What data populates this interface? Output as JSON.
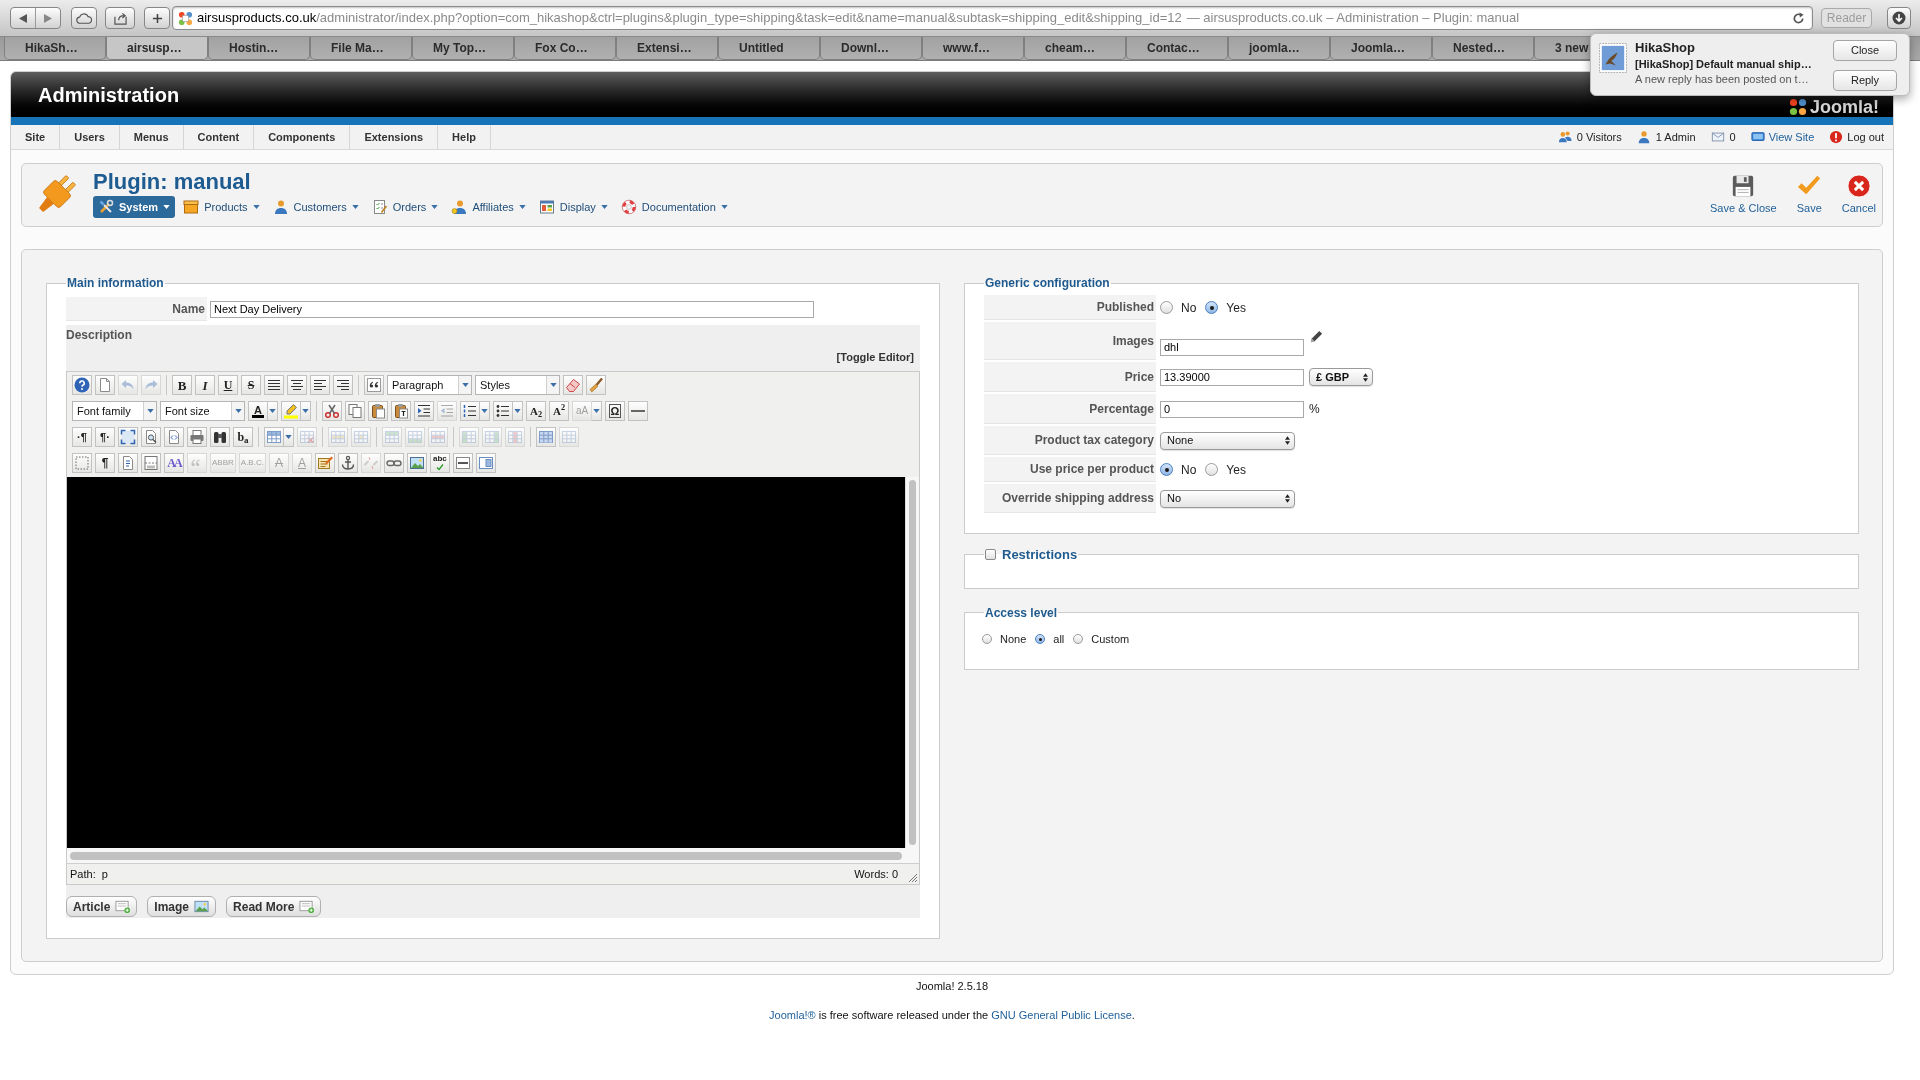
{
  "browser": {
    "url_domain": "airsusproducts.co.uk",
    "url_path": "/administrator/index.php?option=com_hikashop&ctrl=plugins&plugin_type=shipping&task=edit&name=manual&subtask=shipping_edit&shipping_id=12",
    "page_title": "— airsusproducts.co.uk – Administration – Plugin: manual",
    "reader": "Reader",
    "tabs": [
      {
        "label": "HikaSh…",
        "selected": false
      },
      {
        "label": "airsusp…",
        "selected": true
      },
      {
        "label": "Hostin…",
        "selected": false
      },
      {
        "label": "File Ma…",
        "selected": false
      },
      {
        "label": "My Top…",
        "selected": false
      },
      {
        "label": "Fox Co…",
        "selected": false
      },
      {
        "label": "Extensi…",
        "selected": false
      },
      {
        "label": "Untitled",
        "selected": false
      },
      {
        "label": "Downl…",
        "selected": false
      },
      {
        "label": "www.f…",
        "selected": false
      },
      {
        "label": "cheam…",
        "selected": false
      },
      {
        "label": "Contac…",
        "selected": false
      },
      {
        "label": "joomla…",
        "selected": false
      },
      {
        "label": "Joomla…",
        "selected": false
      },
      {
        "label": "Nested…",
        "selected": false
      },
      {
        "label": "3 new",
        "selected": false
      }
    ]
  },
  "notification": {
    "app": "HikaShop",
    "subject": "[HikaShop] Default manual ship…",
    "body": "A new reply has been posted on t…",
    "buttons": [
      "Close",
      "Reply"
    ]
  },
  "header": {
    "title": "Administration",
    "logo": "Joomla!"
  },
  "menu": {
    "items": [
      "Site",
      "Users",
      "Menus",
      "Content",
      "Components",
      "Extensions",
      "Help"
    ],
    "status": [
      {
        "kind": "visitors",
        "label": "0 Visitors"
      },
      {
        "kind": "admins",
        "label": "1 Admin"
      },
      {
        "kind": "messages",
        "label": "0"
      },
      {
        "kind": "view_site",
        "label": "View Site"
      },
      {
        "kind": "logout",
        "label": "Log out"
      }
    ]
  },
  "toolbar": {
    "title": "Plugin: manual",
    "submenu": [
      {
        "kind": "system",
        "label": "System",
        "selected": true
      },
      {
        "kind": "products",
        "label": "Products",
        "selected": false
      },
      {
        "kind": "customers",
        "label": "Customers",
        "selected": false
      },
      {
        "kind": "orders",
        "label": "Orders",
        "selected": false
      },
      {
        "kind": "affiliates",
        "label": "Affiliates",
        "selected": false
      },
      {
        "kind": "display",
        "label": "Display",
        "selected": false
      },
      {
        "kind": "documentation",
        "label": "Documentation",
        "selected": false
      }
    ],
    "actions": [
      {
        "kind": "save_close",
        "label": "Save & Close"
      },
      {
        "kind": "save",
        "label": "Save"
      },
      {
        "kind": "cancel",
        "label": "Cancel"
      }
    ]
  },
  "main_information": {
    "legend": "Main information",
    "name": {
      "label": "Name",
      "value": "Next Day Delivery"
    },
    "description": {
      "label": "Description",
      "toggle": "[Toggle Editor]",
      "toolbar": [
        [
          [
            {
              "kind": "help",
              "disabled": false
            },
            {
              "kind": "newdocument",
              "disabled": false
            },
            {
              "kind": "undo",
              "disabled": true
            },
            {
              "kind": "redo",
              "disabled": true
            }
          ],
          [
            {
              "kind": "bold",
              "glyph": "B",
              "disabled": false
            },
            {
              "kind": "italic",
              "glyph": "I",
              "disabled": false
            },
            {
              "kind": "underline",
              "glyph": "U",
              "disabled": false
            },
            {
              "kind": "strike",
              "glyph": "S",
              "disabled": false
            },
            {
              "kind": "justifyfull",
              "disabled": false
            },
            {
              "kind": "justifycenter",
              "disabled": false
            },
            {
              "kind": "justifyleft",
              "disabled": false
            },
            {
              "kind": "justifyright",
              "disabled": false
            }
          ],
          [
            {
              "kind": "blockquote",
              "disabled": false
            },
            {
              "kind": "select",
              "label": "Paragraph",
              "disabled": false
            },
            {
              "kind": "select",
              "label": "Styles",
              "disabled": false
            },
            {
              "kind": "cleanup",
              "disabled": false
            },
            {
              "kind": "removeformat",
              "disabled": false
            }
          ]
        ],
        [
          [
            {
              "kind": "select",
              "label": "Font family",
              "disabled": false
            },
            {
              "kind": "select",
              "label": "Font size",
              "disabled": false
            },
            {
              "kind": "forecolor",
              "glyph": "A",
              "split": true,
              "disabled": false
            },
            {
              "kind": "hilitecolor",
              "split": true,
              "disabled": false
            }
          ],
          [
            {
              "kind": "cut",
              "disabled": false
            },
            {
              "kind": "copy",
              "disabled": false
            },
            {
              "kind": "paste",
              "disabled": false
            },
            {
              "kind": "pastetext",
              "disabled": false
            },
            {
              "kind": "indent",
              "disabled": false
            },
            {
              "kind": "outdent",
              "disabled": true
            },
            {
              "kind": "numlist",
              "split": true,
              "disabled": false
            },
            {
              "kind": "bullist",
              "split": true,
              "disabled": false
            },
            {
              "kind": "sub",
              "glyph": "A$_{2}$",
              "disabled": false
            },
            {
              "kind": "sup",
              "glyph": "A$^{2}$",
              "disabled": false
            },
            {
              "kind": "fontstyle",
              "glyph": "aA",
              "split": true,
              "disabled": true
            },
            {
              "kind": "charmap",
              "glyph": "Ω",
              "disabled": false
            },
            {
              "kind": "hr",
              "disabled": false
            }
          ]
        ],
        [
          [
            {
              "kind": "ltr",
              "glyph": "·¶",
              "disabled": false
            },
            {
              "kind": "rtl",
              "glyph": "¶·",
              "disabled": false
            },
            {
              "kind": "fullscreen",
              "disabled": false
            },
            {
              "kind": "preview",
              "disabled": false
            },
            {
              "kind": "code",
              "disabled": false
            },
            {
              "kind": "print",
              "disabled": false
            },
            {
              "kind": "find",
              "disabled": false
            },
            {
              "kind": "replace",
              "glyph": "b$_{a}$",
              "disabled": false
            }
          ],
          [
            {
              "kind": "table",
              "split": true,
              "disabled": false
            },
            {
              "kind": "deletetable",
              "disabled": true
            }
          ],
          [
            {
              "kind": "rowprops",
              "disabled": true
            },
            {
              "kind": "cellprops",
              "disabled": true
            }
          ],
          [
            {
              "kind": "rowbefore",
              "disabled": true
            },
            {
              "kind": "rowafter",
              "disabled": true
            },
            {
              "kind": "deleterow",
              "disabled": true
            }
          ],
          [
            {
              "kind": "colbefore",
              "disabled": true
            },
            {
              "kind": "colafter",
              "disabled": true
            },
            {
              "kind": "deletecol",
              "disabled": true
            }
          ],
          [
            {
              "kind": "merge",
              "disabled": false
            },
            {
              "kind": "split",
              "disabled": true
            }
          ]
        ],
        [
          [
            {
              "kind": "visualaid",
              "disabled": false
            },
            {
              "kind": "visualchars",
              "glyph": "¶",
              "disabled": false
            },
            {
              "kind": "template",
              "disabled": false
            },
            {
              "kind": "pagebreak",
              "disabled": false
            },
            {
              "kind": "styleprops",
              "glyph": "AA",
              "disabled": false
            },
            {
              "kind": "cite",
              "disabled": true
            },
            {
              "kind": "abbr",
              "glyph": "ABBR",
              "disabled": true
            },
            {
              "kind": "acronym",
              "glyph": "A.B.C.",
              "disabled": true
            },
            {
              "kind": "del",
              "glyph": "A",
              "disabled": true
            },
            {
              "kind": "ins",
              "glyph": "A",
              "disabled": true
            },
            {
              "kind": "attribs",
              "disabled": false
            },
            {
              "kind": "anchor",
              "disabled": false
            },
            {
              "kind": "unlink",
              "disabled": true
            },
            {
              "kind": "link",
              "disabled": false
            },
            {
              "kind": "image",
              "disabled": false
            },
            {
              "kind": "spellchecker",
              "glyph": "abc",
              "disabled": false
            },
            {
              "kind": "advhr",
              "disabled": false
            },
            {
              "kind": "layer",
              "disabled": false
            }
          ]
        ]
      ],
      "path_label": "Path:",
      "path": "p",
      "words": "Words: 0"
    },
    "buttons": [
      {
        "kind": "article",
        "label": "Article"
      },
      {
        "kind": "image",
        "label": "Image"
      },
      {
        "kind": "readmore",
        "label": "Read More"
      }
    ]
  },
  "generic_configuration": {
    "legend": "Generic configuration",
    "rows": [
      {
        "label": "Published",
        "kind": "radio",
        "options": [
          {
            "label": "No",
            "selected": false
          },
          {
            "label": "Yes",
            "selected": true
          }
        ]
      },
      {
        "label": "Images",
        "kind": "input",
        "value": "dhl",
        "edit": true
      },
      {
        "label": "Price",
        "kind": "input",
        "value": "13.39000",
        "currency": "£ GBP"
      },
      {
        "label": "Percentage",
        "kind": "input",
        "value": "0",
        "suffix": "%"
      },
      {
        "label": "Product tax category",
        "kind": "select",
        "value": "None"
      },
      {
        "label": "Use price per product",
        "kind": "radio",
        "options": [
          {
            "label": "No",
            "selected": true
          },
          {
            "label": "Yes",
            "selected": false
          }
        ]
      },
      {
        "label": "Override shipping address",
        "kind": "select",
        "value": "No"
      }
    ]
  },
  "restrictions": {
    "legend": "Restrictions",
    "checked": false
  },
  "access_level": {
    "legend": "Access level",
    "options": [
      {
        "label": "None",
        "selected": false
      },
      {
        "label": "all",
        "selected": true
      },
      {
        "label": "Custom",
        "selected": false
      }
    ]
  },
  "footer": {
    "version": "Joomla! 2.5.18",
    "license": {
      "link": "Joomla!®",
      "text": " is free software released under the ",
      "license_link": "GNU General Public License",
      "end": "."
    }
  }
}
